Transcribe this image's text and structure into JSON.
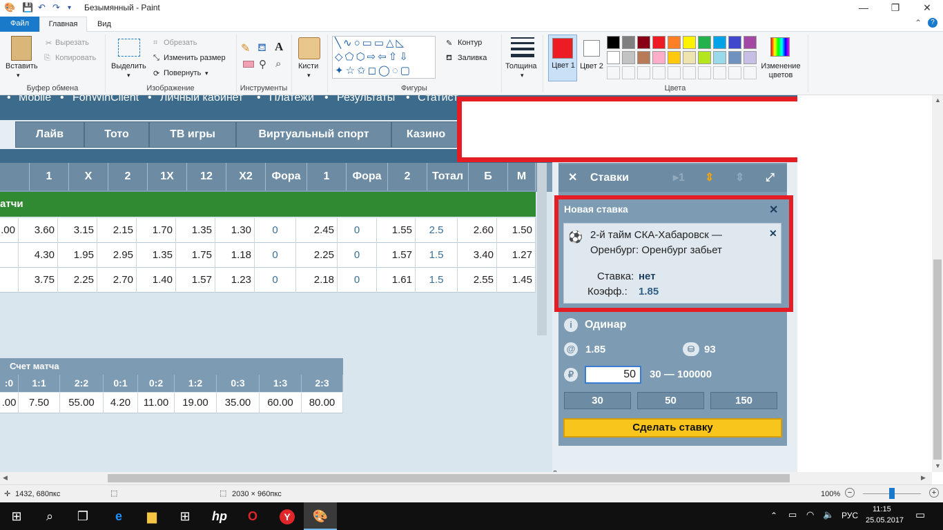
{
  "titlebar": {
    "title": "Безымянный - Paint"
  },
  "tabs": {
    "file": "Файл",
    "home": "Главная",
    "view": "Вид"
  },
  "ribbon": {
    "clipboard": {
      "paste": "Вставить",
      "cut": "Вырезать",
      "copy": "Копировать",
      "label": "Буфер обмена"
    },
    "image": {
      "select": "Выделить",
      "crop": "Обрезать",
      "resize": "Изменить размер",
      "rotate": "Повернуть",
      "label": "Изображение"
    },
    "tools": {
      "label": "Инструменты"
    },
    "brushes": {
      "label": "Кисти"
    },
    "shapes": {
      "outline": "Контур",
      "fill": "Заливка",
      "label": "Фигуры"
    },
    "size": {
      "label": "Толщина"
    },
    "colors": {
      "color1": "Цвет 1",
      "color2": "Цвет 2",
      "edit": "Изменение цветов",
      "label": "Цвета",
      "color1_value": "#ed1c24",
      "color2_value": "#ffffff",
      "palette": [
        "#000000",
        "#7f7f7f",
        "#880015",
        "#ed1c24",
        "#ff7f27",
        "#fff200",
        "#22b14c",
        "#00a2e8",
        "#3f48cc",
        "#a349a4",
        "#ffffff",
        "#c3c3c3",
        "#b97a57",
        "#ffaec9",
        "#ffc90e",
        "#efe4b0",
        "#b5e61d",
        "#99d9ea",
        "#7092be",
        "#c8bfe7"
      ]
    }
  },
  "site": {
    "nav": [
      "Mobile",
      "FonWinClient",
      "Личный кабинет",
      "Платежи",
      "Результаты",
      "Статист"
    ],
    "tabs": [
      "Лайв",
      "Тото",
      "ТВ игры",
      "Виртуальный спорт",
      "Казино"
    ],
    "headers": [
      "1",
      "X",
      "2",
      "1X",
      "12",
      "X2",
      "Фора",
      "1",
      "Фора",
      "2",
      "Тотал",
      "Б",
      "М"
    ],
    "group": "атчи",
    "rows": [
      [
        ".00",
        "3.60",
        "3.15",
        "2.15",
        "1.70",
        "1.35",
        "1.30",
        "0",
        "2.45",
        "0",
        "1.55",
        "2.5",
        "2.60",
        "1.50"
      ],
      [
        "",
        "4.30",
        "1.95",
        "2.95",
        "1.35",
        "1.75",
        "1.18",
        "0",
        "2.25",
        "0",
        "1.57",
        "1.5",
        "3.40",
        "1.27"
      ],
      [
        "",
        "3.75",
        "2.25",
        "2.70",
        "1.40",
        "1.57",
        "1.23",
        "0",
        "2.18",
        "0",
        "1.61",
        "1.5",
        "2.55",
        "1.45"
      ]
    ],
    "score": {
      "title": "Счет матча",
      "heads": [
        ":0",
        "1:1",
        "2:2",
        "0:1",
        "0:2",
        "1:2",
        "0:3",
        "1:3",
        "2:3"
      ],
      "values": [
        ".00",
        "7.50",
        "55.00",
        "4.20",
        "11.00",
        "19.00",
        "35.00",
        "60.00",
        "80.00"
      ]
    }
  },
  "bets": {
    "title": "Ставки",
    "newbet": "Новая ставка",
    "event_line1": "2-й тайм СКА-Хабаровск —",
    "event_line2": "Оренбург: Оренбург забьет",
    "stake_label": "Ставка:",
    "stake_value": "нет",
    "coef_label": "Коэфф.:",
    "coef_value": "1.85",
    "single": "Одинар",
    "at_value": "1.85",
    "coins_value": "93",
    "amount": "50",
    "range": "30 — 100000",
    "quick": [
      "30",
      "50",
      "150"
    ],
    "submit": "Сделать ставку"
  },
  "status": {
    "cursor": "1432, 680пкс",
    "size": "2030 × 960пкс",
    "zoom": "100%"
  },
  "taskbar": {
    "lang": "РУС",
    "time": "11:15",
    "date": "25.05.2017"
  }
}
